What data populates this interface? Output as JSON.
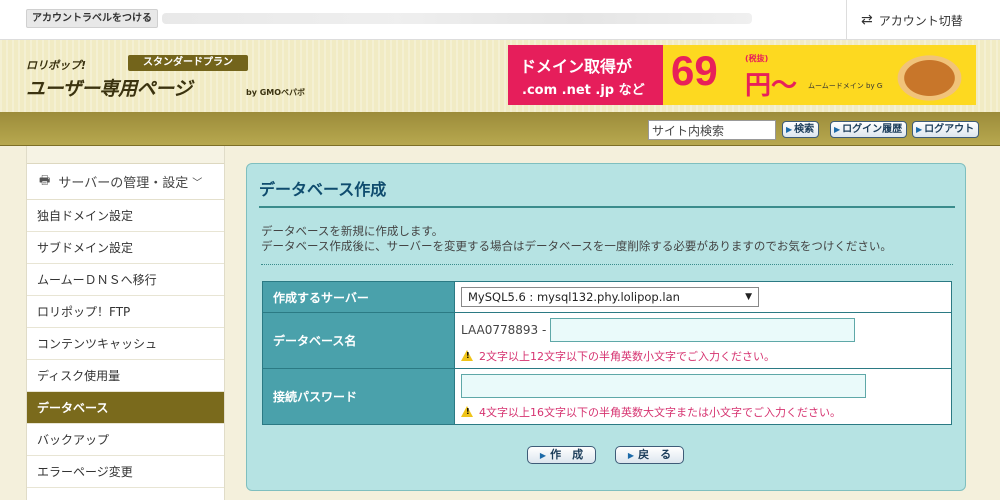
{
  "topbar": {
    "account_label_button": "アカウントラベルをつける",
    "account_switch": "アカウント切替"
  },
  "header": {
    "brand": "ロリポップ!",
    "plan": "スタンダードプラン",
    "title": "ユーザー専用ページ",
    "by": "by GMOペパボ"
  },
  "banner": {
    "line1": "ドメイン取得が",
    "line2": ".com .net .jp など",
    "price": "69",
    "tax": "(税抜)",
    "yen": "円〜",
    "service": "ムームードメイン by GMOペパボ"
  },
  "search": {
    "value": "サイト内検索",
    "search_button": "検索",
    "login_history_button": "ログイン履歴",
    "logout_button": "ログアウト"
  },
  "sidebar": {
    "section": "サーバーの管理・設定",
    "items": [
      {
        "label": "独自ドメイン設定"
      },
      {
        "label": "サブドメイン設定"
      },
      {
        "label": "ムームーＤＮＳへ移行"
      },
      {
        "label": "ロリポップ！FTP"
      },
      {
        "label": "コンテンツキャッシュ"
      },
      {
        "label": "ディスク使用量"
      },
      {
        "label": "データベース"
      },
      {
        "label": "バックアップ"
      },
      {
        "label": "エラーページ変更"
      }
    ]
  },
  "main": {
    "title": "データベース作成",
    "desc1": "データベースを新規に作成します。",
    "desc2": "データベース作成後に、サーバーを変更する場合はデータベースを一度削除する必要がありますのでお気をつけください。",
    "server_label": "作成するサーバー",
    "server_value": "MySQL5.6 : mysql132.phy.lolipop.lan",
    "dbname_label": "データベース名",
    "dbname_prefix": "LAA0778893 -",
    "dbname_hint": "2文字以上12文字以下の半角英数小文字でご入力ください。",
    "password_label": "接続パスワード",
    "password_hint": "4文字以上16文字以下の半角英数大文字または小文字でご入力ください。",
    "create_button": "作　成",
    "back_button": "戻　る"
  }
}
